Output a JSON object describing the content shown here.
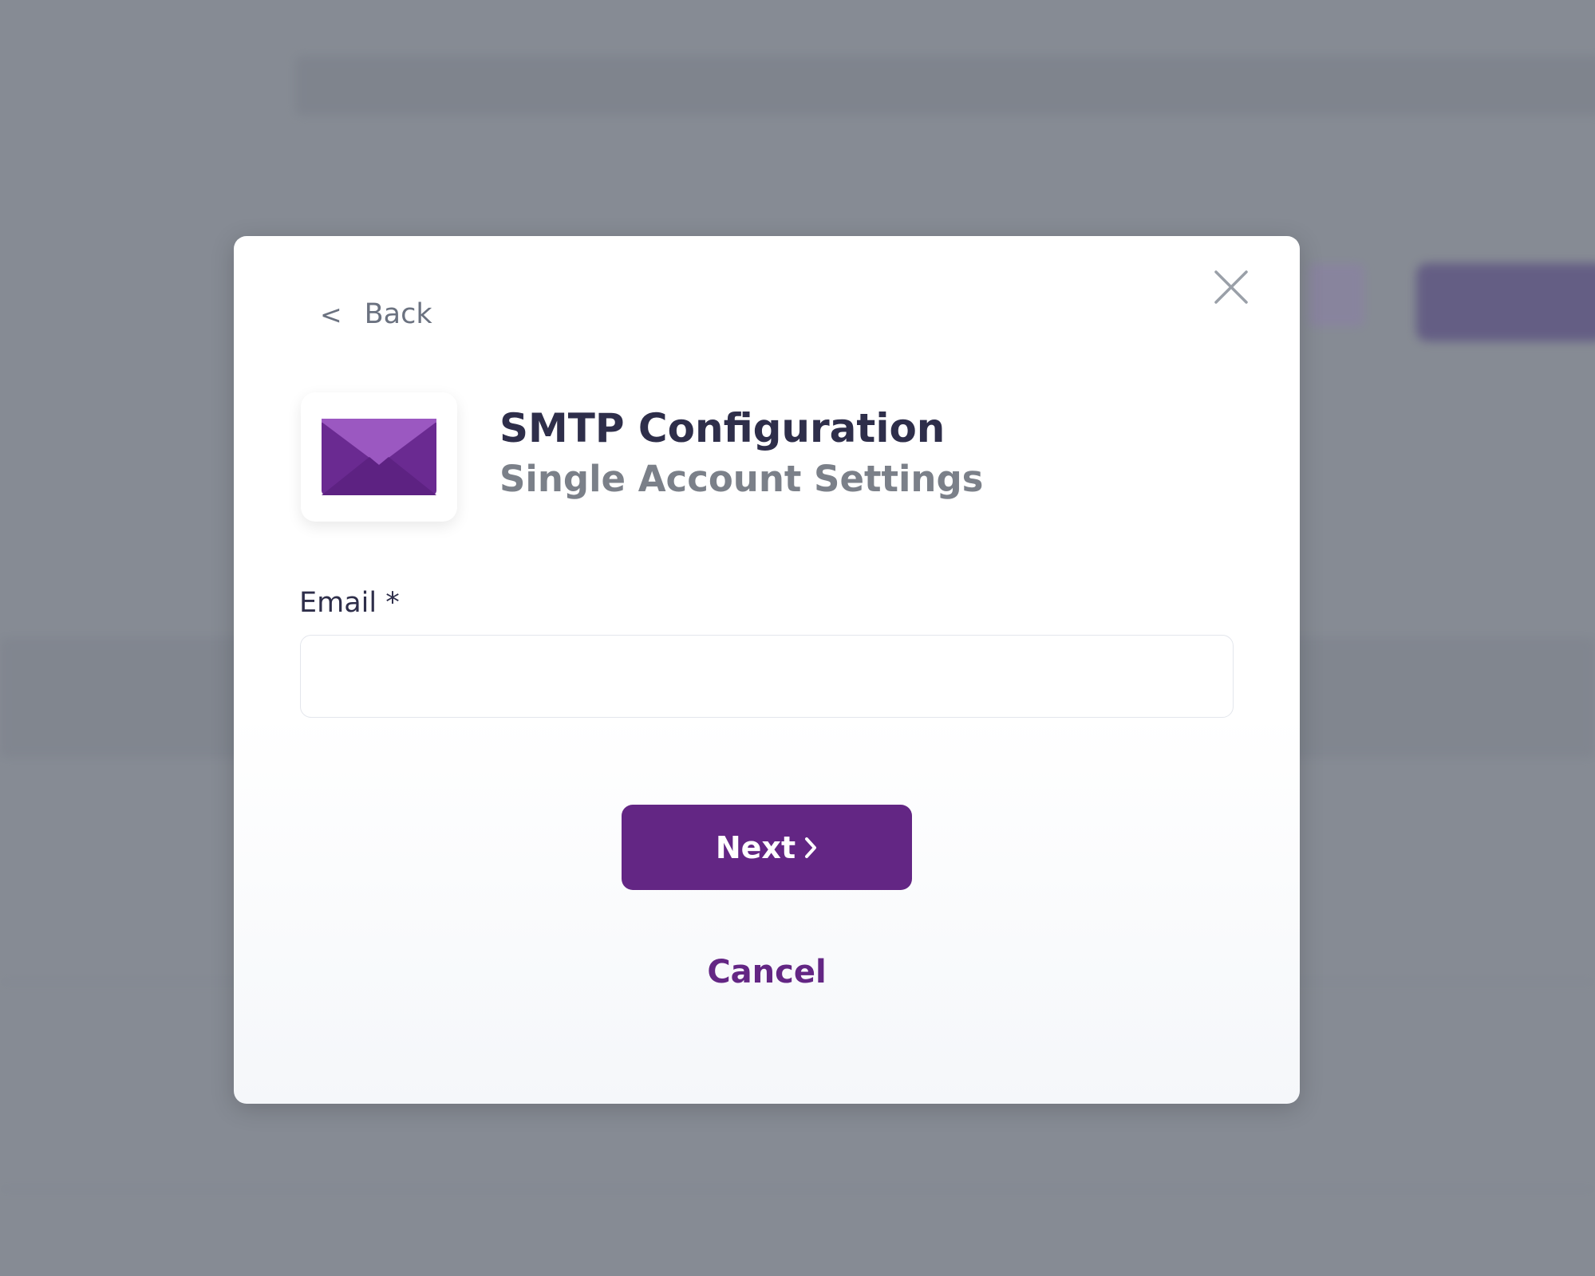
{
  "dialog": {
    "back_label": "Back",
    "back_chevron": "<",
    "title": "SMTP Configuration",
    "subtitle": "Single Account Settings",
    "logo_icon": "envelope-icon",
    "close_icon": "close-icon",
    "email": {
      "label": "Email *",
      "value": "",
      "placeholder": ""
    },
    "next_label": "Next",
    "next_icon": "chevron-right-icon",
    "cancel_label": "Cancel"
  },
  "colors": {
    "accent": "#632684",
    "envelope_light": "#9b58c1",
    "envelope_dark": "#6a2a91",
    "title": "#2e2e4a",
    "subtitle": "#7b8089",
    "overlay": "#868b94"
  }
}
